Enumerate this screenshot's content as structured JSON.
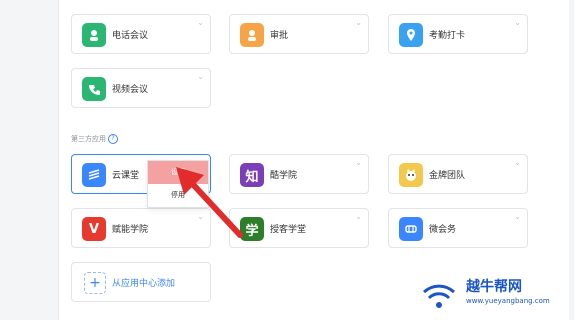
{
  "apps_top": [
    {
      "label": "电话会议",
      "icon": "phone-user-icon",
      "color": "#2bb673"
    },
    {
      "label": "审批",
      "icon": "user-icon",
      "color": "#f5a548"
    },
    {
      "label": "考勤打卡",
      "icon": "location-pin-icon",
      "color": "#3aa0f0"
    },
    {
      "label": "视频会议",
      "icon": "video-call-icon",
      "color": "#2bb673"
    }
  ],
  "section": {
    "title": "第三方应用",
    "help": "?"
  },
  "apps_third": [
    {
      "label": "云课堂",
      "icon": "cloud-class-icon",
      "color": "#3a86ff"
    },
    {
      "label": "酷学院",
      "icon": "zhi-icon",
      "glyph": "知",
      "color": "#7b3fb8"
    },
    {
      "label": "金牌团队",
      "icon": "cat-mascot-icon",
      "color": "#f2c94c"
    },
    {
      "label": "赋能学院",
      "icon": "v-logo-icon",
      "glyph": "V",
      "color": "#e63a2f"
    },
    {
      "label": "授客学堂",
      "icon": "xue-icon",
      "glyph": "学",
      "color": "#2d7d2a"
    },
    {
      "label": "微会务",
      "icon": "meeting-link-icon",
      "color": "#3a86ff"
    }
  ],
  "context_menu": {
    "settings": "设置",
    "disable": "停用"
  },
  "add_app": {
    "label": "从应用中心添加",
    "icon": "plus"
  },
  "watermark": {
    "title": "越牛帮网",
    "url": "www.yueyangbang.com"
  },
  "colors": {
    "accent": "#3a86ff",
    "arrow": "#e22b2b",
    "highlight": "#f3a1a1"
  }
}
